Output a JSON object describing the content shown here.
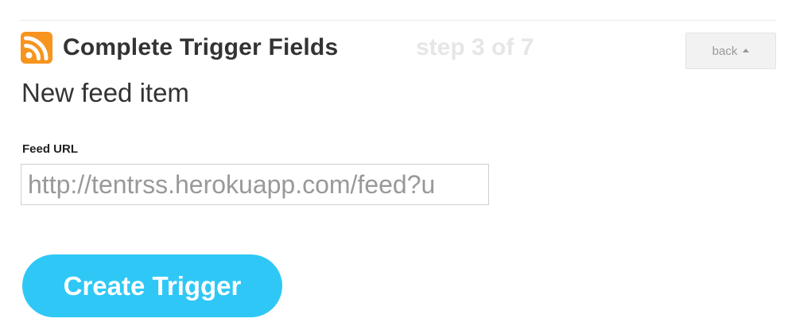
{
  "header": {
    "channel_icon": "rss-feed-icon",
    "title": "Complete Trigger Fields",
    "step_text": "step 3 of 7",
    "back_label": "back",
    "back_icon": "caret-up-icon"
  },
  "trigger": {
    "name": "New feed item"
  },
  "form": {
    "feed_url": {
      "label": "Feed URL",
      "value": "http://tentrss.herokuapp.com/feed?u"
    },
    "submit_label": "Create Trigger"
  },
  "colors": {
    "rss_orange": "#f7941d",
    "button_blue": "#2fc8f6",
    "step_gray": "#e6e6e6"
  }
}
